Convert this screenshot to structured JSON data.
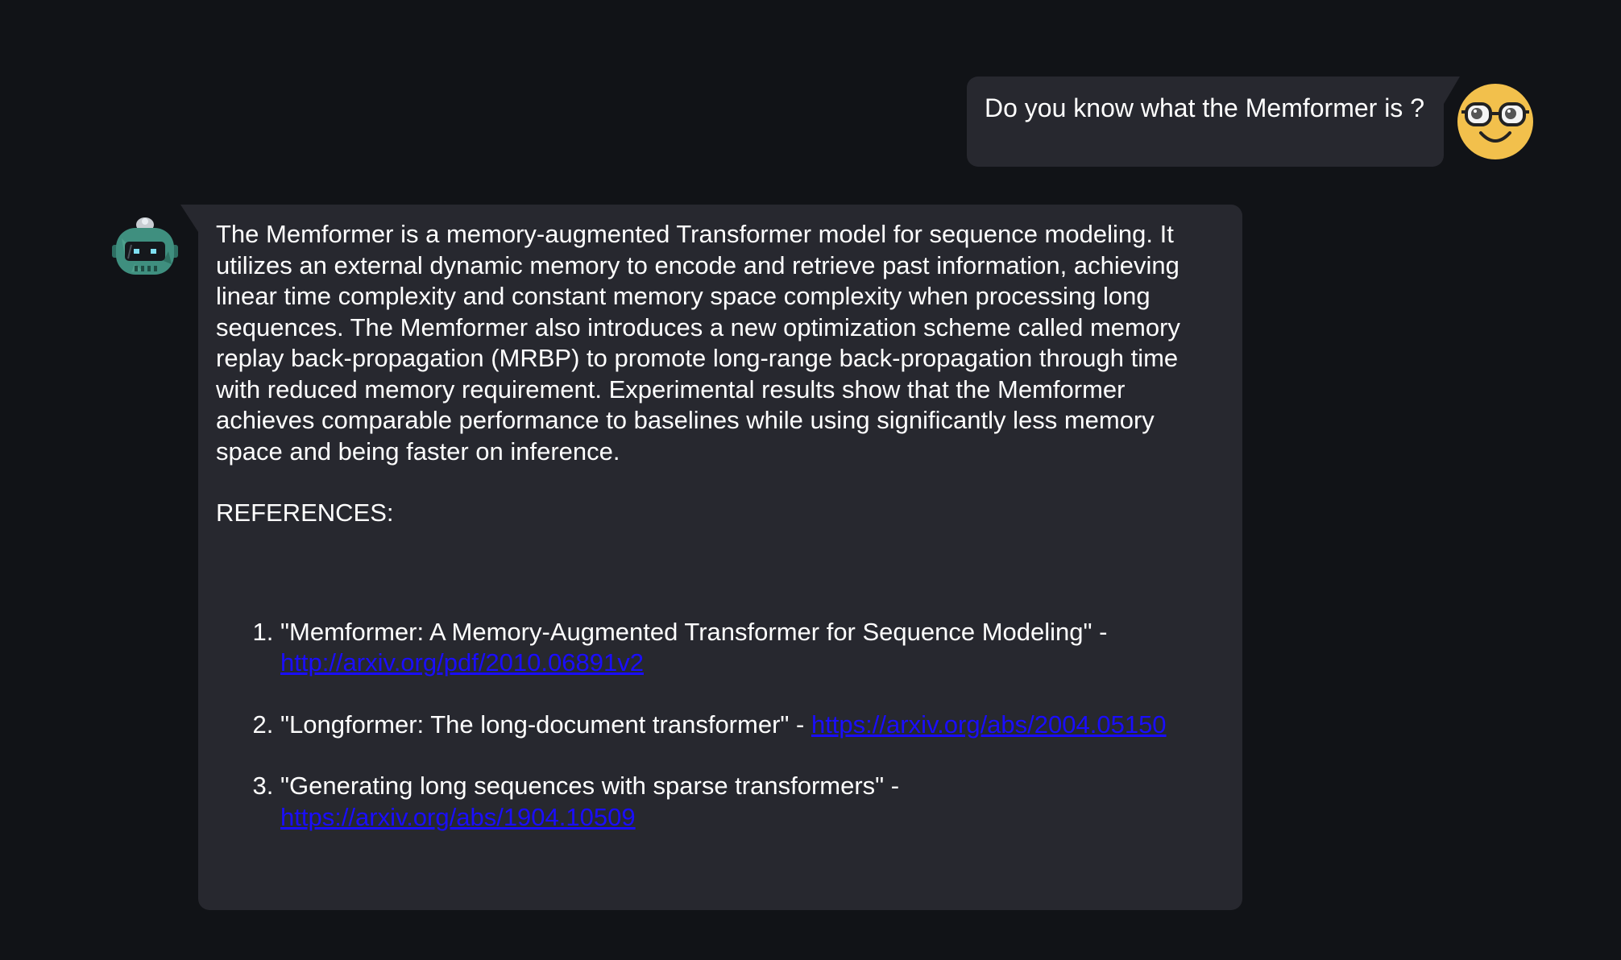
{
  "conversation": {
    "user_message": {
      "text": "Do you know what the Memformer is ?",
      "avatar_icon": "nerd-face-icon"
    },
    "bot_message": {
      "avatar_icon": "robot-icon",
      "paragraph": "The Memformer is a memory-augmented Transformer model for sequence modeling. It utilizes an external dynamic memory to encode and retrieve past information, achieving linear time complexity and constant memory space complexity when processing long sequences. The Memformer also introduces a new optimization scheme called memory replay back-propagation (MRBP) to promote long-range back-propagation through time with reduced memory requirement. Experimental results show that the Memformer achieves comparable performance to baselines while using significantly less memory space and being faster on inference.",
      "references_heading": "REFERENCES:",
      "references": [
        {
          "title": "\"Memformer: A Memory-Augmented Transformer for Sequence Modeling\" - ",
          "url": "http://arxiv.org/pdf/2010.06891v2"
        },
        {
          "title": "\"Longformer: The long-document transformer\" - ",
          "url": "https://arxiv.org/abs/2004.05150"
        },
        {
          "title": "\"Generating long sequences with sparse transformers\" - ",
          "url": "https://arxiv.org/abs/1904.10509"
        }
      ]
    }
  },
  "colors": {
    "background": "#111317",
    "bubble": "#27282f",
    "text": "#ffffff",
    "link": "#1a0dff",
    "user_avatar": "#f2c04c",
    "bot_avatar": "#3f8f7f"
  }
}
